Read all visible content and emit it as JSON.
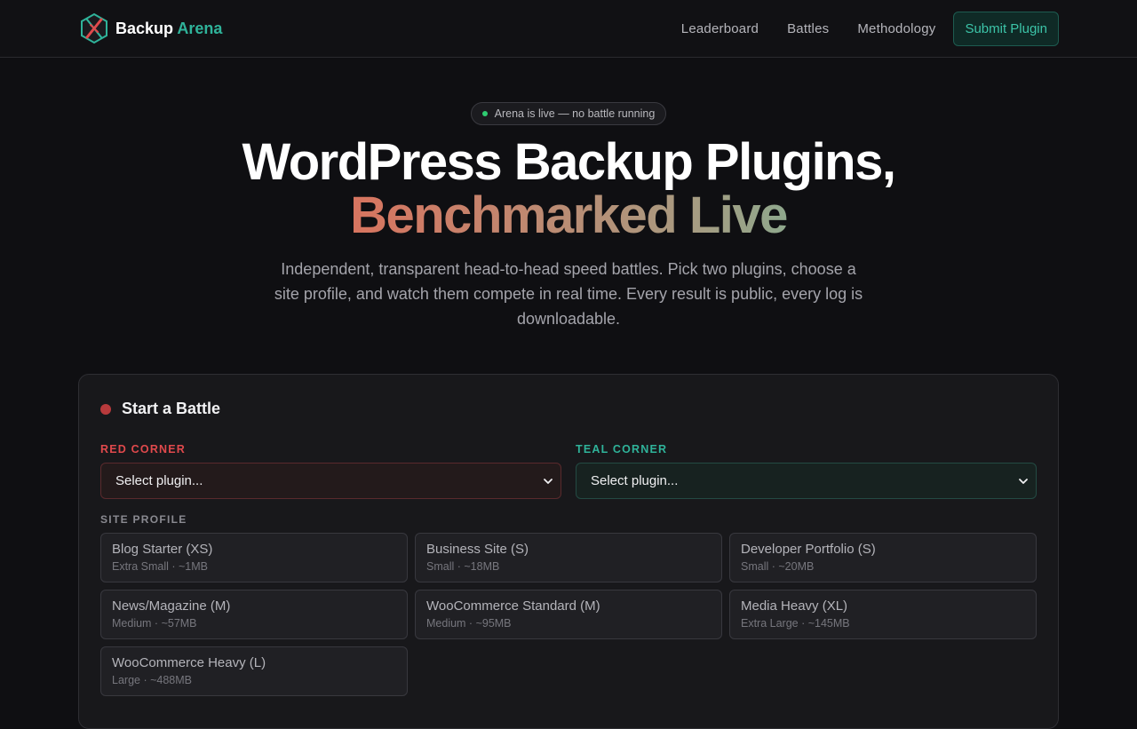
{
  "brand": {
    "name": "Backup",
    "accent": "Arena"
  },
  "nav": {
    "links": [
      "Leaderboard",
      "Battles",
      "Methodology"
    ],
    "cta": "Submit Plugin"
  },
  "hero": {
    "status": "Arena is live — no battle running",
    "title_line1": "WordPress Backup Plugins,",
    "title_line2": "Benchmarked Live",
    "lede": "Independent, transparent head-to-head speed battles. Pick two plugins, choose a site profile, and watch them compete in real time. Every result is public, every log is downloadable."
  },
  "battle": {
    "title": "Start a Battle",
    "red_label": "RED CORNER",
    "red_value": "Select plugin...",
    "teal_label": "TEAL CORNER",
    "teal_value": "Select plugin...",
    "profile_label": "SITE PROFILE",
    "profiles": [
      {
        "name": "Blog Starter (XS)",
        "meta": "Extra Small · ~1MB"
      },
      {
        "name": "Business Site (S)",
        "meta": "Small · ~18MB"
      },
      {
        "name": "Developer Portfolio (S)",
        "meta": "Small · ~20MB"
      },
      {
        "name": "News/Magazine (M)",
        "meta": "Medium · ~57MB"
      },
      {
        "name": "WooCommerce Standard (M)",
        "meta": "Medium · ~95MB"
      },
      {
        "name": "Media Heavy (XL)",
        "meta": "Extra Large · ~145MB"
      },
      {
        "name": "WooCommerce Heavy (L)",
        "meta": "Large · ~488MB"
      }
    ]
  },
  "colors": {
    "red": "#e0494c",
    "teal": "#2fb39a",
    "live": "#2ecc71",
    "background": "#0f0f12"
  },
  "icons": [
    "arena-logo-icon",
    "live-dot-icon",
    "chevron-down-icon"
  ]
}
